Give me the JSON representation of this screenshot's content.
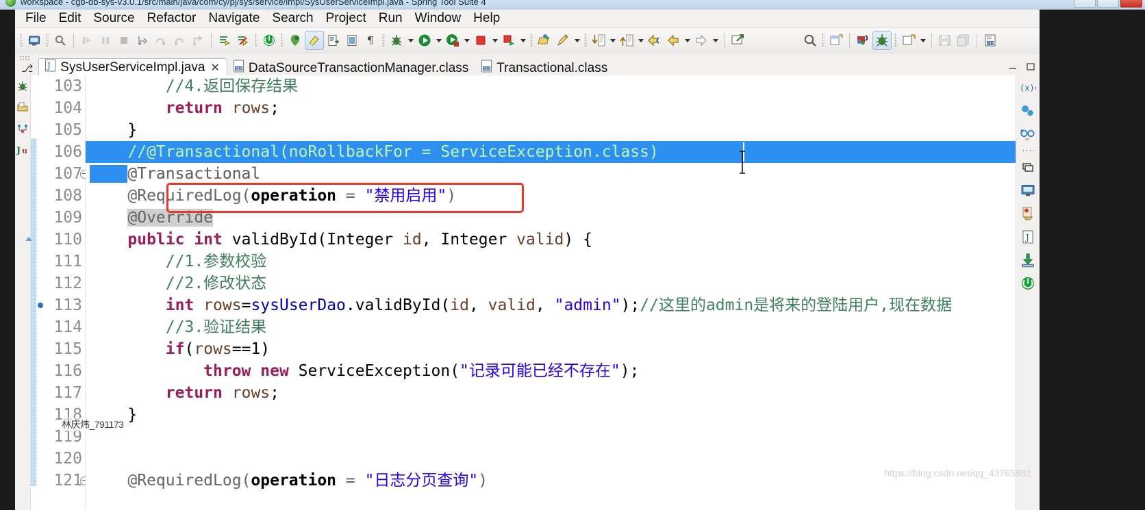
{
  "window": {
    "title": "workspace - cgb-db-sys-v3.0.1/src/main/java/com/cy/pj/sys/service/impl/SysUserServiceImpl.java - Spring Tool Suite 4",
    "minimize_label": "–",
    "maximize_label": "❐",
    "close_label": "✕"
  },
  "menubar": {
    "items": [
      {
        "label": "File"
      },
      {
        "label": "Edit"
      },
      {
        "label": "Source"
      },
      {
        "label": "Refactor"
      },
      {
        "label": "Navigate"
      },
      {
        "label": "Search"
      },
      {
        "label": "Project"
      },
      {
        "label": "Run"
      },
      {
        "label": "Window"
      },
      {
        "label": "Help"
      }
    ]
  },
  "toolbar": {
    "icons": [
      "new-wizard-icon",
      "save-icon",
      "resume-icon",
      "suspend-icon",
      "terminate-icon",
      "step-into-icon",
      "step-over-icon",
      "step-return-icon",
      "drop-to-frame-icon",
      "build-all-icon",
      "skip-breakpoints-icon",
      "boot-dashboard-icon",
      "spring-icon",
      "edit-highlight-icon",
      "open-type-icon",
      "open-resource-icon",
      "pilcrow-icon",
      "debug-icon",
      "run-icon",
      "run-coverage-icon",
      "stop-icon",
      "external-tools-icon",
      "open-perspective-icon",
      "quick-access-icon",
      "next-annotation-icon",
      "previous-annotation-icon",
      "back-icon",
      "forward-icon",
      "new-editor-icon",
      "search-icon",
      "new-java-project-icon",
      "spring-bean-icon",
      "debug-perspective-icon",
      "new-wizard-2-icon",
      "save-2-icon",
      "save-all-icon",
      "toggle-breakpoint-icon"
    ]
  },
  "tabs": {
    "pin_glyph": "⎇",
    "items": [
      {
        "label": "SysUserServiceImpl.java",
        "icon": "java-file-icon",
        "active": true,
        "close_glyph": "✕"
      },
      {
        "label": "DataSourceTransactionManager.class",
        "icon": "class-file-icon",
        "active": false
      },
      {
        "label": "Transactional.class",
        "icon": "class-file-icon",
        "active": false
      }
    ]
  },
  "side_icons": [
    "spring-explorer-icon",
    "package-explorer-icon",
    "outline-icon",
    "junit-icon"
  ],
  "fastview_icons": [
    "variables-icon",
    "breakpoints-icon",
    "expressions-icon",
    "dots-divider",
    "servers-icon",
    "console-icon",
    "problems-icon",
    "javadoc-icon",
    "install-icon",
    "boot-dashboard-icon"
  ],
  "editor": {
    "first_visible_line": 103,
    "lines": [
      {
        "n": "103",
        "text": "        //4.返回保存结果",
        "clipped": true
      },
      {
        "n": "104",
        "text": "        return rows;"
      },
      {
        "n": "105",
        "text": "    }"
      },
      {
        "n": "106",
        "text": "    //@Transactional(noRollbackFor = ServiceException.class)",
        "selected": true
      },
      {
        "n": "107",
        "text": "    @Transactional",
        "folding": "collapse"
      },
      {
        "n": "108",
        "text": "    @RequiredLog(operation = \"禁用启用\")",
        "highlighted_box": true
      },
      {
        "n": "109",
        "text": "    @Override"
      },
      {
        "n": "110",
        "text": "    public int validById(Integer id, Integer valid) {",
        "folding": "triangle"
      },
      {
        "n": "111",
        "text": "        //1.参数校验"
      },
      {
        "n": "112",
        "text": "        //2.修改状态"
      },
      {
        "n": "113",
        "text": "        int rows=sysUserDao.validById(id, valid, \"admin\");//这里的admin是将来的登陆用户,现在数据",
        "breakpoint": true
      },
      {
        "n": "114",
        "text": "        //3.验证结果"
      },
      {
        "n": "115",
        "text": "        if(rows==1)"
      },
      {
        "n": "116",
        "text": "            throw new ServiceException(\"记录可能已经不存在\");"
      },
      {
        "n": "117",
        "text": "        return rows;"
      },
      {
        "n": "118",
        "text": "    }"
      },
      {
        "n": "119",
        "text": ""
      },
      {
        "n": "120",
        "text": ""
      },
      {
        "n": "121",
        "text": "    @RequiredLog(operation = \"日志分页查询\")",
        "folding": "collapse",
        "clipped": true
      }
    ]
  },
  "annotations": {
    "red_box_target": "@RequiredLog(operation = \"禁用启用\")",
    "red_box_color": "#e8372c",
    "selection_color": "#2d8ff0",
    "override_highlight_color": "#cfcfcf"
  },
  "watermarks": {
    "user": "林庆炜_791173",
    "url": "https://blog.csdn.net/qq_43765881"
  }
}
